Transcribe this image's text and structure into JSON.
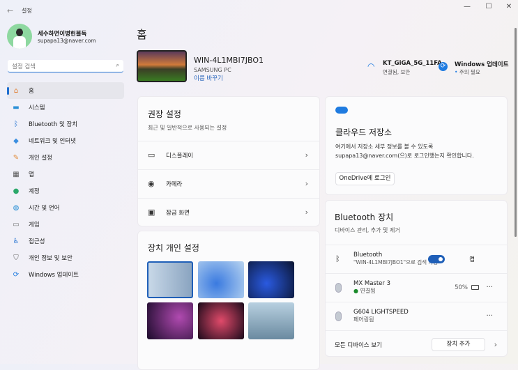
{
  "window": {
    "title": "설정",
    "back": "←",
    "minimize": "—",
    "maximize": "☐",
    "close": "✕"
  },
  "user": {
    "name": "세수하면이병헌블독",
    "email": "supapa13@naver.com"
  },
  "search": {
    "placeholder": "설정 검색",
    "icon": "⌕"
  },
  "nav": [
    {
      "label": "홈",
      "icon": "home-icon",
      "glyph": "⌂",
      "color": "#e07a2a"
    },
    {
      "label": "시스템",
      "icon": "monitor-icon",
      "glyph": "▬",
      "color": "#2a8fd6"
    },
    {
      "label": "Bluetooth 및 장치",
      "icon": "bluetooth-icon",
      "glyph": "ᛒ",
      "color": "#1f6fd0"
    },
    {
      "label": "네트워크 및 인터넷",
      "icon": "network-icon",
      "glyph": "◆",
      "color": "#3a8ee0"
    },
    {
      "label": "개인 설정",
      "icon": "brush-icon",
      "glyph": "✎",
      "color": "#e08a3a"
    },
    {
      "label": "앱",
      "icon": "apps-icon",
      "glyph": "▦",
      "color": "#555"
    },
    {
      "label": "계정",
      "icon": "account-icon",
      "glyph": "●",
      "color": "#2aa86a"
    },
    {
      "label": "시간 및 언어",
      "icon": "globe-icon",
      "glyph": "◍",
      "color": "#2a8fd6"
    },
    {
      "label": "게임",
      "icon": "gamepad-icon",
      "glyph": "▭",
      "color": "#777"
    },
    {
      "label": "접근성",
      "icon": "accessibility-icon",
      "glyph": "♿",
      "color": "#1f6fd0"
    },
    {
      "label": "개인 정보 및 보안",
      "icon": "shield-icon",
      "glyph": "⛉",
      "color": "#666"
    },
    {
      "label": "Windows 업데이트",
      "icon": "update-icon",
      "glyph": "⟳",
      "color": "#1f7be0"
    }
  ],
  "main": {
    "title": "홈"
  },
  "pc": {
    "name": "WIN-4L1MBI7JBO1",
    "model": "SAMSUNG PC",
    "rename": "이름 바꾸기"
  },
  "wifi": {
    "name": "KT_GiGA_5G_11FA",
    "status": "연결됨, 보안",
    "glyph": "◠"
  },
  "update": {
    "title": "Windows 업데이트",
    "status": "주의 필요",
    "glyph": "⟳"
  },
  "recommended": {
    "title": "권장 설정",
    "subtitle": "최근 및 일반적으로 사용되는 설정",
    "items": [
      {
        "label": "디스플레이",
        "glyph": "▭"
      },
      {
        "label": "카메라",
        "glyph": "◉"
      },
      {
        "label": "잠금 화면",
        "glyph": "▣"
      }
    ],
    "chevron": "›"
  },
  "personalize": {
    "title": "장치 개인 설정"
  },
  "cloud": {
    "title": "클라우드 저장소",
    "desc1": "여기에서 저장소 세부 정보를 볼 수 있도록",
    "desc2": "supapa13@naver.com(으)로 로그인했는지 확인합니다.",
    "button": "OneDrive에 로그인"
  },
  "bluetooth": {
    "title": "Bluetooth 장치",
    "subtitle": "디바이스 관리, 추가 및 제거",
    "bt_label": "Bluetooth",
    "bt_desc": "\"WIN-4L1MBI7JBO1\"으로 검색 가능",
    "toggle_label": "켬",
    "toggle_on": true,
    "devices": [
      {
        "name": "MX Master 3",
        "status": "연결됨",
        "battery": "50%"
      },
      {
        "name": "G604 LIGHTSPEED",
        "status": "페어링됨"
      }
    ],
    "view_all": "모든 디바이스 보기",
    "add": "장치 추가",
    "more": "···"
  }
}
